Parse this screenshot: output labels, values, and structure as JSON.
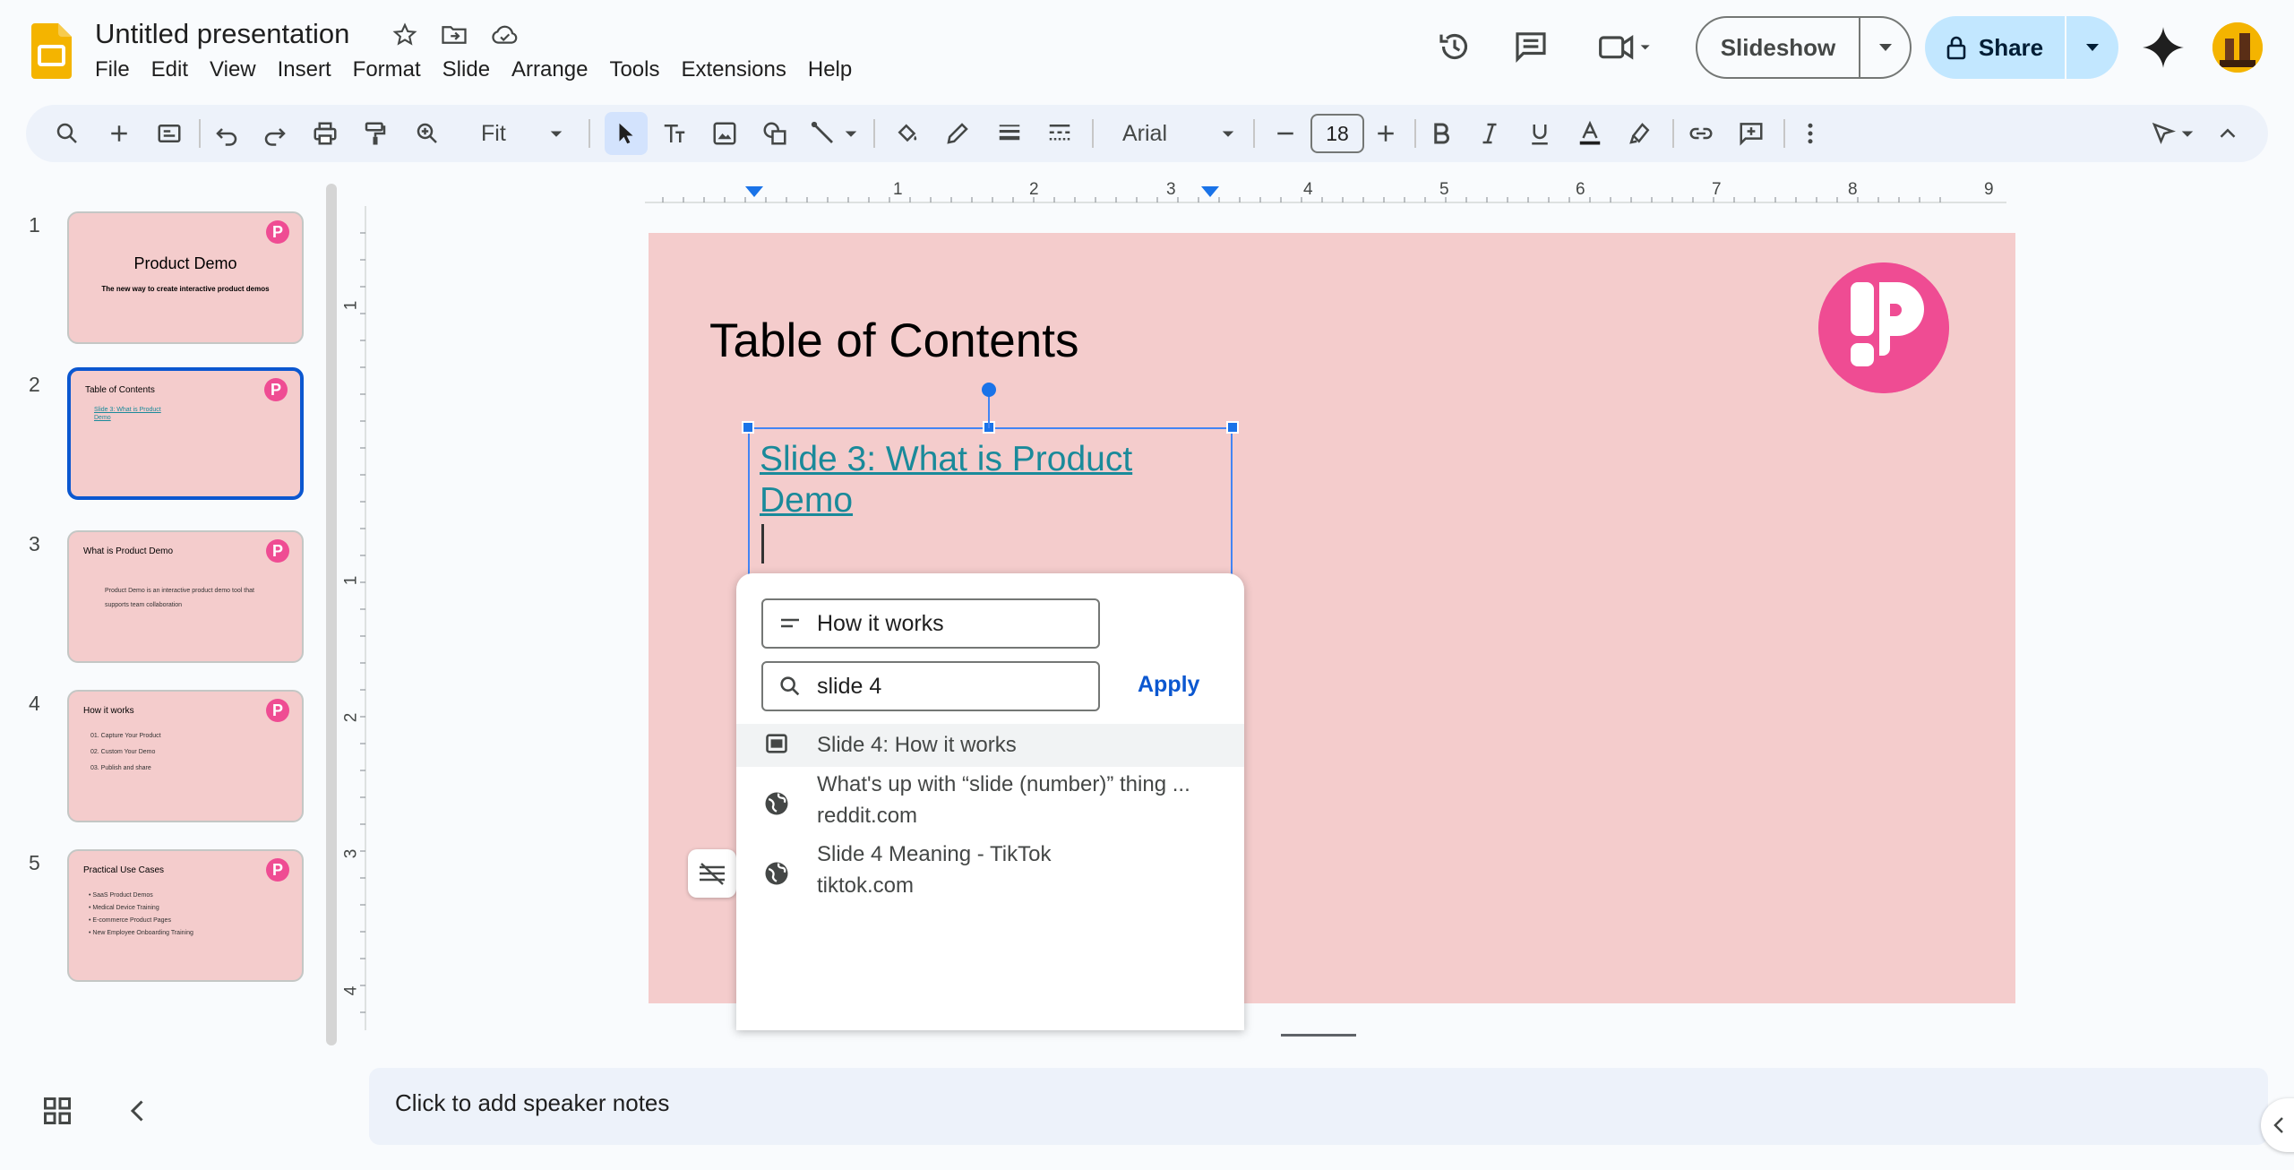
{
  "app": {
    "title": "Untitled presentation",
    "menu": [
      "File",
      "Edit",
      "View",
      "Insert",
      "Format",
      "Slide",
      "Arrange",
      "Tools",
      "Extensions",
      "Help"
    ],
    "slideshow_label": "Slideshow",
    "share_label": "Share",
    "colors": {
      "accent": "#0b57d0",
      "share_bg": "#c2e7ff",
      "toolbar_bg": "#edf2fa",
      "slide_bg": "#f4cccc",
      "logo_pink": "#ef4c93",
      "link": "#1a8a9a"
    }
  },
  "toolbar": {
    "zoom": "Fit",
    "font": "Arial",
    "font_size": "18"
  },
  "filmstrip": {
    "slides": [
      {
        "number": "1",
        "title": "Product Demo",
        "subtitle": "The new way to create interactive product demos",
        "lines": []
      },
      {
        "number": "2",
        "title": "Table of Contents",
        "lines": [
          "Slide 3: What is Product",
          "Demo"
        ]
      },
      {
        "number": "3",
        "title": "What is Product Demo",
        "lines": [
          "Product Demo is an interactive product demo tool that",
          "supports team collaboration"
        ]
      },
      {
        "number": "4",
        "title": "How it works",
        "lines": [
          "01. Capture Your Product",
          "02. Custom Your Demo",
          "03. Publish and share"
        ]
      },
      {
        "number": "5",
        "title": "Practical Use Cases",
        "lines": [
          "SaaS Product Demos",
          "Medical Device Training",
          "E-commerce Product Pages",
          "New Employee Onboarding Training"
        ]
      }
    ],
    "selected": 2
  },
  "ruler": {
    "h": [
      "1",
      "2",
      "3",
      "4",
      "5",
      "6",
      "7",
      "8",
      "9"
    ],
    "v": [
      "1",
      "1",
      "2",
      "3",
      "4"
    ]
  },
  "slide": {
    "title": "Table of Contents",
    "link_text": "Slide 3: What is Product Demo"
  },
  "link_popup": {
    "text_value": "How it works",
    "search_value": "slide 4",
    "apply_label": "Apply",
    "suggestions": [
      {
        "icon": "slide-icon",
        "line1": "Slide 4: How it works",
        "line2": ""
      },
      {
        "icon": "globe-icon",
        "line1": "What's up with “slide (number)” thing ...",
        "line2": "reddit.com"
      },
      {
        "icon": "globe-icon",
        "line1": "Slide 4 Meaning - TikTok",
        "line2": "tiktok.com"
      }
    ]
  },
  "notes": {
    "placeholder": "Click to add speaker notes"
  }
}
